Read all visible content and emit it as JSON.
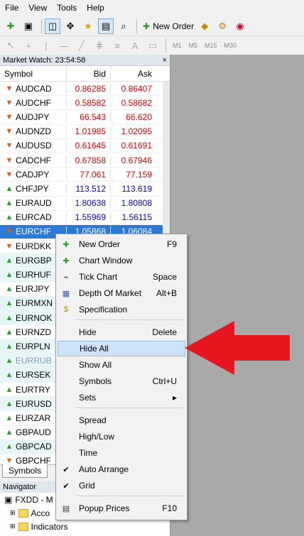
{
  "menu": [
    "File",
    "View",
    "Tools",
    "Help"
  ],
  "toolbar": {
    "new_order_label": "New Order",
    "timeframes": [
      "M1",
      "M5",
      "M15",
      "M30"
    ]
  },
  "market_watch": {
    "title": "Market Watch: 23:54:58",
    "close_glyph": "×",
    "headers": {
      "symbol": "Symbol",
      "bid": "Bid",
      "ask": "Ask"
    },
    "rows": [
      {
        "symbol": "AUDCAD",
        "bid": "0.86285",
        "ask": "0.86407",
        "dir": "down"
      },
      {
        "symbol": "AUDCHF",
        "bid": "0.58582",
        "ask": "0.58682",
        "dir": "down"
      },
      {
        "symbol": "AUDJPY",
        "bid": "66.543",
        "ask": "66.620",
        "dir": "down"
      },
      {
        "symbol": "AUDNZD",
        "bid": "1.01985",
        "ask": "1.02095",
        "dir": "down"
      },
      {
        "symbol": "AUDUSD",
        "bid": "0.61645",
        "ask": "0.61691",
        "dir": "down"
      },
      {
        "symbol": "CADCHF",
        "bid": "0.67858",
        "ask": "0.67946",
        "dir": "down"
      },
      {
        "symbol": "CADJPY",
        "bid": "77.061",
        "ask": "77.159",
        "dir": "down"
      },
      {
        "symbol": "CHFJPY",
        "bid": "113.512",
        "ask": "113.619",
        "dir": "up"
      },
      {
        "symbol": "EURAUD",
        "bid": "1.80638",
        "ask": "1.80808",
        "dir": "up"
      },
      {
        "symbol": "EURCAD",
        "bid": "1.55969",
        "ask": "1.56115",
        "dir": "up"
      },
      {
        "symbol": "EURCHF",
        "bid": "1.05868",
        "ask": "1.06084",
        "dir": "down"
      },
      {
        "symbol": "EURDKK",
        "bid": "",
        "ask": "",
        "dir": "down"
      },
      {
        "symbol": "EURGBP",
        "bid": "",
        "ask": "",
        "dir": "up"
      },
      {
        "symbol": "EURHUF",
        "bid": "",
        "ask": "",
        "dir": "up"
      },
      {
        "symbol": "EURJPY",
        "bid": "",
        "ask": "",
        "dir": "up"
      },
      {
        "symbol": "EURMXN",
        "bid": "",
        "ask": "",
        "dir": "up"
      },
      {
        "symbol": "EURNOK",
        "bid": "",
        "ask": "",
        "dir": "up"
      },
      {
        "symbol": "EURNZD",
        "bid": "",
        "ask": "",
        "dir": "up"
      },
      {
        "symbol": "EURPLN",
        "bid": "",
        "ask": "",
        "dir": "up"
      },
      {
        "symbol": "EURRUB",
        "bid": "",
        "ask": "",
        "dir": "up"
      },
      {
        "symbol": "EURSEK",
        "bid": "",
        "ask": "",
        "dir": "up"
      },
      {
        "symbol": "EURTRY",
        "bid": "",
        "ask": "",
        "dir": "up"
      },
      {
        "symbol": "EURUSD",
        "bid": "",
        "ask": "",
        "dir": "up"
      },
      {
        "symbol": "EURZAR",
        "bid": "",
        "ask": "",
        "dir": "up"
      },
      {
        "symbol": "GBPAUD",
        "bid": "",
        "ask": "",
        "dir": "up"
      },
      {
        "symbol": "GBPCAD",
        "bid": "",
        "ask": "",
        "dir": "up"
      },
      {
        "symbol": "GBPCHF",
        "bid": "",
        "ask": "",
        "dir": "down"
      }
    ],
    "selected_symbol": "EURCHF",
    "tab_label": "Symbols"
  },
  "navigator": {
    "title": "Navigator",
    "close_glyph": "×",
    "items": [
      "FXDD - M",
      "Acco",
      "Indicators"
    ]
  },
  "context_menu": {
    "items": [
      {
        "label": "New Order",
        "shortcut": "F9",
        "icon": "new-order-icon"
      },
      {
        "label": "Chart Window",
        "shortcut": "",
        "icon": "chart-window-icon"
      },
      {
        "label": "Tick Chart",
        "shortcut": "Space",
        "icon": "tick-chart-icon"
      },
      {
        "label": "Depth Of Market",
        "shortcut": "Alt+B",
        "icon": "depth-of-market-icon"
      },
      {
        "label": "Specification",
        "shortcut": "",
        "icon": "specification-icon"
      },
      {
        "label": "Hide",
        "shortcut": "Delete",
        "icon": ""
      },
      {
        "label": "Hide All",
        "shortcut": "",
        "icon": ""
      },
      {
        "label": "Show All",
        "shortcut": "",
        "icon": ""
      },
      {
        "label": "Symbols",
        "shortcut": "Ctrl+U",
        "icon": ""
      },
      {
        "label": "Sets",
        "shortcut": "",
        "icon": "submenu-arrow"
      },
      {
        "label": "Spread",
        "shortcut": "",
        "icon": ""
      },
      {
        "label": "High/Low",
        "shortcut": "",
        "icon": ""
      },
      {
        "label": "Time",
        "shortcut": "",
        "icon": ""
      },
      {
        "label": "Auto Arrange",
        "shortcut": "",
        "icon": "check-icon"
      },
      {
        "label": "Grid",
        "shortcut": "",
        "icon": "check-icon"
      },
      {
        "label": "Popup Prices",
        "shortcut": "F10",
        "icon": "popup-prices-icon"
      }
    ],
    "highlighted": "Hide All"
  },
  "colors": {
    "selection": "#2b7ad6",
    "bid_ask_red": "#e00000",
    "bid_ask_blue": "#0000dd",
    "annotation_arrow": "#e8161e"
  }
}
